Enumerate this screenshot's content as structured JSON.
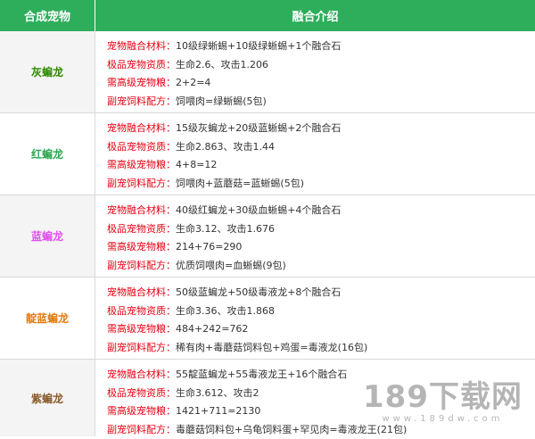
{
  "header": {
    "col1": "合成宠物",
    "col2": "融合介绍"
  },
  "labels": {
    "material": "宠物融合材料：",
    "quality": "极品宠物资质：",
    "food": "需高级宠物粮：",
    "recipe": "副宠饲料配方："
  },
  "colors": {
    "header_bg": "#2eae5b",
    "label_red": "#e60012",
    "pet1": "#2e8b00",
    "pet2": "#2aa84f",
    "pet3": "#e14ff0",
    "pet4": "#e07a10",
    "pet5": "#8a5a2a"
  },
  "rows": [
    {
      "name": "灰蝙龙",
      "material": "10级绿蜥蜴+10级绿蜥蜴+1个融合石",
      "quality": "生命2.6、攻击1.206",
      "food": "2+2=4",
      "recipe": "饲喂肉=绿蜥蜴(5包)"
    },
    {
      "name": "红蝙龙",
      "material": "15级灰蝙龙+20级蓝蜥蜴+2个融合石",
      "quality": "生命2.863、攻击1.44",
      "food": "4+8=12",
      "recipe": "饲喂肉+蓝蘑菇=蓝蜥蜴(5包)"
    },
    {
      "name": "蓝蝙龙",
      "material": "40级红蝙龙+30级血蜥蜴+4个融合石",
      "quality": "生命3.12、攻击1.676",
      "food": "214+76=290",
      "recipe": "优质饲喂肉=血蜥蜴(9包)"
    },
    {
      "name": "靛蓝蝙龙",
      "material": "50级蓝蝙龙+50级毒液龙+8个融合石",
      "quality": "生命3.36、攻击1.868",
      "food": "484+242=762",
      "recipe": "稀有肉+毒蘑菇饲料包+鸡蛋=毒液龙(16包)"
    },
    {
      "name": "紫蝙龙",
      "material": "55靛蓝蝙龙+55毒液龙王+16个融合石",
      "quality": "生命3.612、攻击2",
      "food": "1421+711=2130",
      "recipe": "毒蘑菇饲料包+乌龟饲料蛋+罕见肉=毒液龙王(21包)"
    }
  ],
  "watermark": {
    "brand": "189下载网",
    "url": "www.189dw.com"
  }
}
